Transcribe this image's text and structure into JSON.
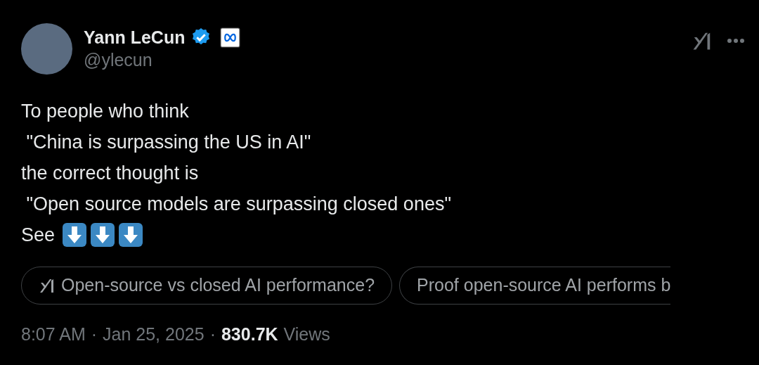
{
  "author": {
    "name": "Yann LeCun",
    "verified": true,
    "handle": "@ylecun"
  },
  "tweet_lines": [
    "To people who think",
    " \"China is surpassing the US in AI\"",
    "the correct thought is",
    " \"Open source models are surpassing closed ones\"",
    "See"
  ],
  "suggestions": [
    {
      "label": "Open-source vs closed AI performance?",
      "kind": "grok"
    },
    {
      "label": "Proof open-source AI performs b",
      "kind": "plain"
    }
  ],
  "meta": {
    "time": "8:07 AM",
    "separator_1": "·",
    "date": "Jan 25, 2025",
    "separator_2": "·",
    "views": "830.7K",
    "views_label": "Views"
  }
}
